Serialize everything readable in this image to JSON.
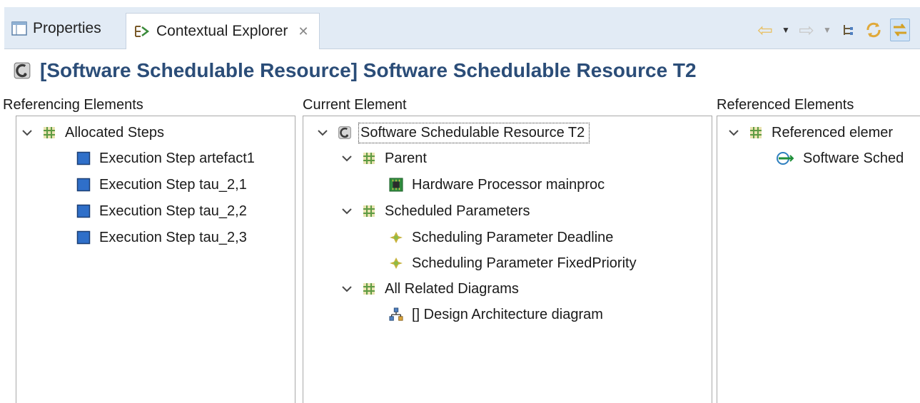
{
  "tabs": {
    "properties_label": "Properties",
    "explorer_label": "Contextual Explorer",
    "close_glyph": "✕"
  },
  "toolbar": {
    "icons": [
      "back-arrow-icon",
      "dropdown-icon",
      "forward-arrow-icon",
      "dropdown-icon",
      "tree-layout-icon",
      "refresh-icon",
      "link-with-editor-icon"
    ]
  },
  "header": {
    "title": "[Software Schedulable Resource] Software Schedulable Resource T2"
  },
  "columns": {
    "referencing_label": "Referencing Elements",
    "current_label": "Current Element",
    "referenced_label": "Referenced Elements"
  },
  "referencing": {
    "group_label": "Allocated Steps",
    "items": [
      "Execution Step artefact1",
      "Execution Step tau_2,1",
      "Execution Step tau_2,2",
      "Execution Step tau_2,3"
    ]
  },
  "current": {
    "root_label": "Software Schedulable Resource T2",
    "parent_label": "Parent",
    "parent_item": "Hardware Processor mainproc",
    "params_label": "Scheduled Parameters",
    "params_items": [
      "Scheduling Parameter Deadline",
      "Scheduling Parameter FixedPriority"
    ],
    "diagrams_label": "All Related Diagrams",
    "diagram_item": "[] Design Architecture diagram"
  },
  "referenced": {
    "group_label": "Referenced elemer",
    "item": "Software Sched"
  },
  "colors": {
    "title_blue": "#2b4d78",
    "tab_bar": "#e2ebf5",
    "step_blue": "#2f6fc9",
    "package_green": "#6aa84f",
    "param_gold": "#c6b23a"
  }
}
